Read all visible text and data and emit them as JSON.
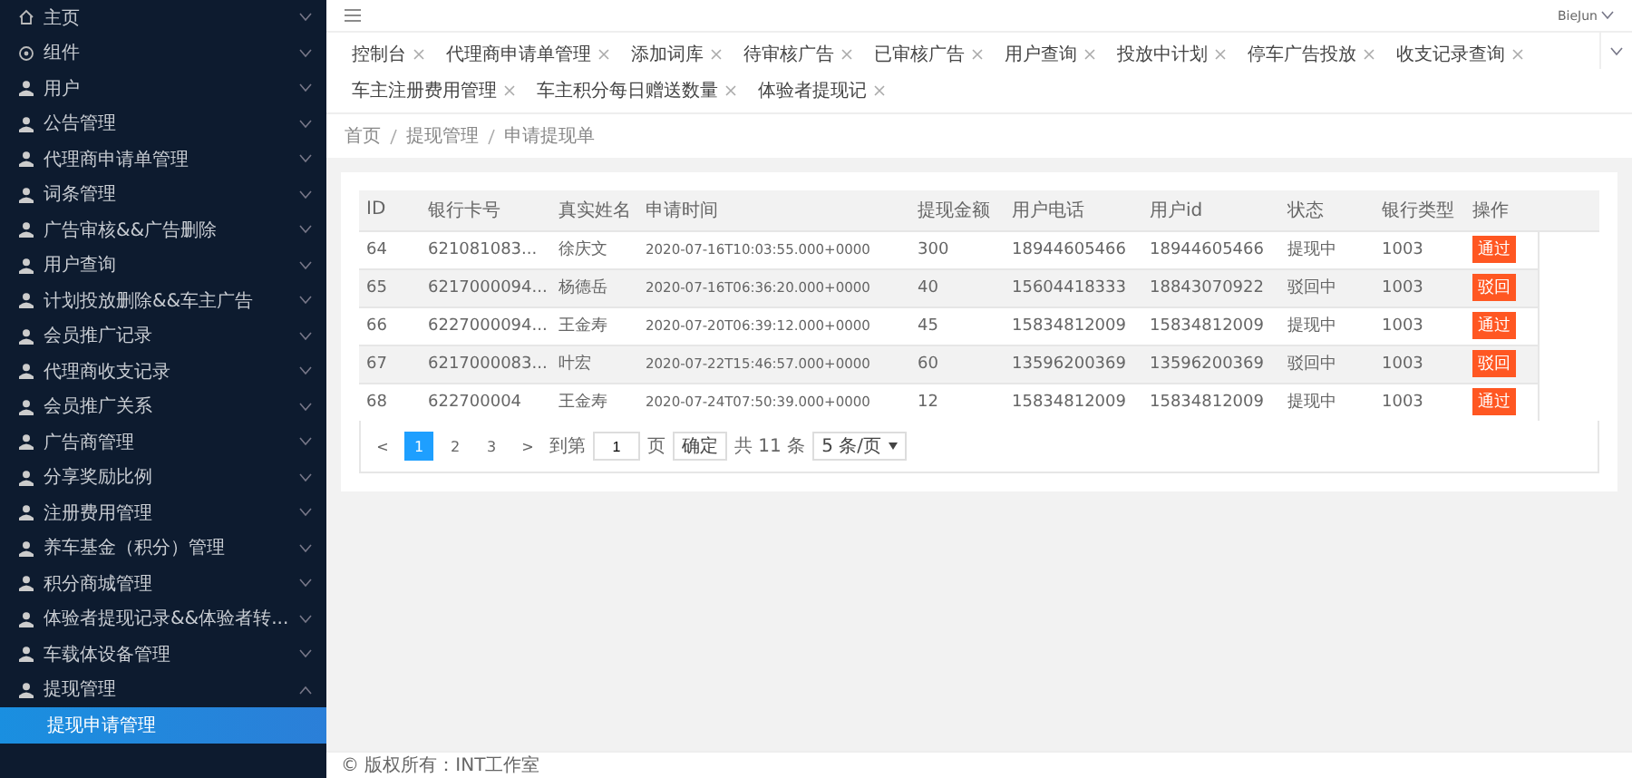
{
  "sidebar": {
    "items": [
      {
        "label": "主页",
        "kind": "home",
        "expanded": false
      },
      {
        "label": "组件",
        "kind": "gear",
        "expanded": false
      },
      {
        "label": "用户",
        "expanded": false
      },
      {
        "label": "公告管理",
        "expanded": false
      },
      {
        "label": "代理商申请单管理",
        "expanded": false
      },
      {
        "label": "词条管理",
        "expanded": false
      },
      {
        "label": "广告审核&&广告删除",
        "expanded": false
      },
      {
        "label": "用户查询",
        "expanded": false
      },
      {
        "label": "计划投放删除&&车主广告",
        "expanded": false
      },
      {
        "label": "会员推广记录",
        "expanded": false
      },
      {
        "label": "代理商收支记录",
        "expanded": false
      },
      {
        "label": "会员推广关系",
        "expanded": false
      },
      {
        "label": "广告商管理",
        "expanded": false
      },
      {
        "label": "分享奖励比例",
        "expanded": false
      },
      {
        "label": "注册费用管理",
        "expanded": false
      },
      {
        "label": "养车基金（积分）管理",
        "expanded": false
      },
      {
        "label": "积分商城管理",
        "expanded": false
      },
      {
        "label": "体验者提现记录&&体验者转...",
        "expanded": false
      },
      {
        "label": "车载体设备管理",
        "expanded": false
      },
      {
        "label": "提现管理",
        "expanded": true,
        "children": [
          {
            "label": "提现申请管理",
            "selected": true
          }
        ]
      }
    ]
  },
  "header": {
    "user": "BieJun"
  },
  "tabs": [
    {
      "label": "控制台"
    },
    {
      "label": "代理商申请单管理"
    },
    {
      "label": "添加词库"
    },
    {
      "label": "待审核广告"
    },
    {
      "label": "已审核广告"
    },
    {
      "label": "用户查询"
    },
    {
      "label": "投放中计划"
    },
    {
      "label": "停车广告投放"
    },
    {
      "label": "收支记录查询"
    },
    {
      "label": "车主注册费用管理"
    },
    {
      "label": "车主积分每日赠送数量"
    },
    {
      "label": "体验者提现记"
    }
  ],
  "breadcrumb": [
    "首页",
    "提现管理",
    "申请提现单"
  ],
  "table": {
    "columns": [
      "ID",
      "银行卡号",
      "真实姓名",
      "申请时间",
      "提现金额",
      "用户电话",
      "用户id",
      "状态",
      "银行类型",
      "操作"
    ],
    "rows": [
      {
        "cells": [
          "64",
          "621081083...",
          "徐庆文",
          "2020-07-16T10:03:55.000+0000",
          "300",
          "18944605466",
          "18944605466",
          "提现中",
          "1003"
        ],
        "action": "通过"
      },
      {
        "cells": [
          "65",
          "6217000094...",
          "杨德岳",
          "2020-07-16T06:36:20.000+0000",
          "40",
          "15604418333",
          "18843070922",
          "驳回中",
          "1003"
        ],
        "action": "驳回"
      },
      {
        "cells": [
          "66",
          "6227000094...",
          "王金寿",
          "2020-07-20T06:39:12.000+0000",
          "45",
          "15834812009",
          "15834812009",
          "提现中",
          "1003"
        ],
        "action": "通过"
      },
      {
        "cells": [
          "67",
          "6217000083...",
          "叶宏",
          "2020-07-22T15:46:57.000+0000",
          "60",
          "13596200369",
          "13596200369",
          "驳回中",
          "1003"
        ],
        "action": "驳回"
      },
      {
        "cells": [
          "68",
          "622700004",
          "王金寿",
          "2020-07-24T07:50:39.000+0000",
          "12",
          "15834812009",
          "15834812009",
          "提现中",
          "1003"
        ],
        "action": "通过"
      }
    ]
  },
  "pagination": {
    "prev": "<",
    "pages": [
      {
        "label": "1",
        "selected": true
      },
      {
        "label": "2",
        "selected": false
      },
      {
        "label": "3",
        "selected": false
      }
    ],
    "next": ">",
    "goto_label": "到第",
    "goto_value": "1",
    "page_unit": "页",
    "confirm": "确定",
    "total": "共 11 条",
    "page_size": "5 条/页"
  },
  "footer": "© 版权所有：INT工作室"
}
